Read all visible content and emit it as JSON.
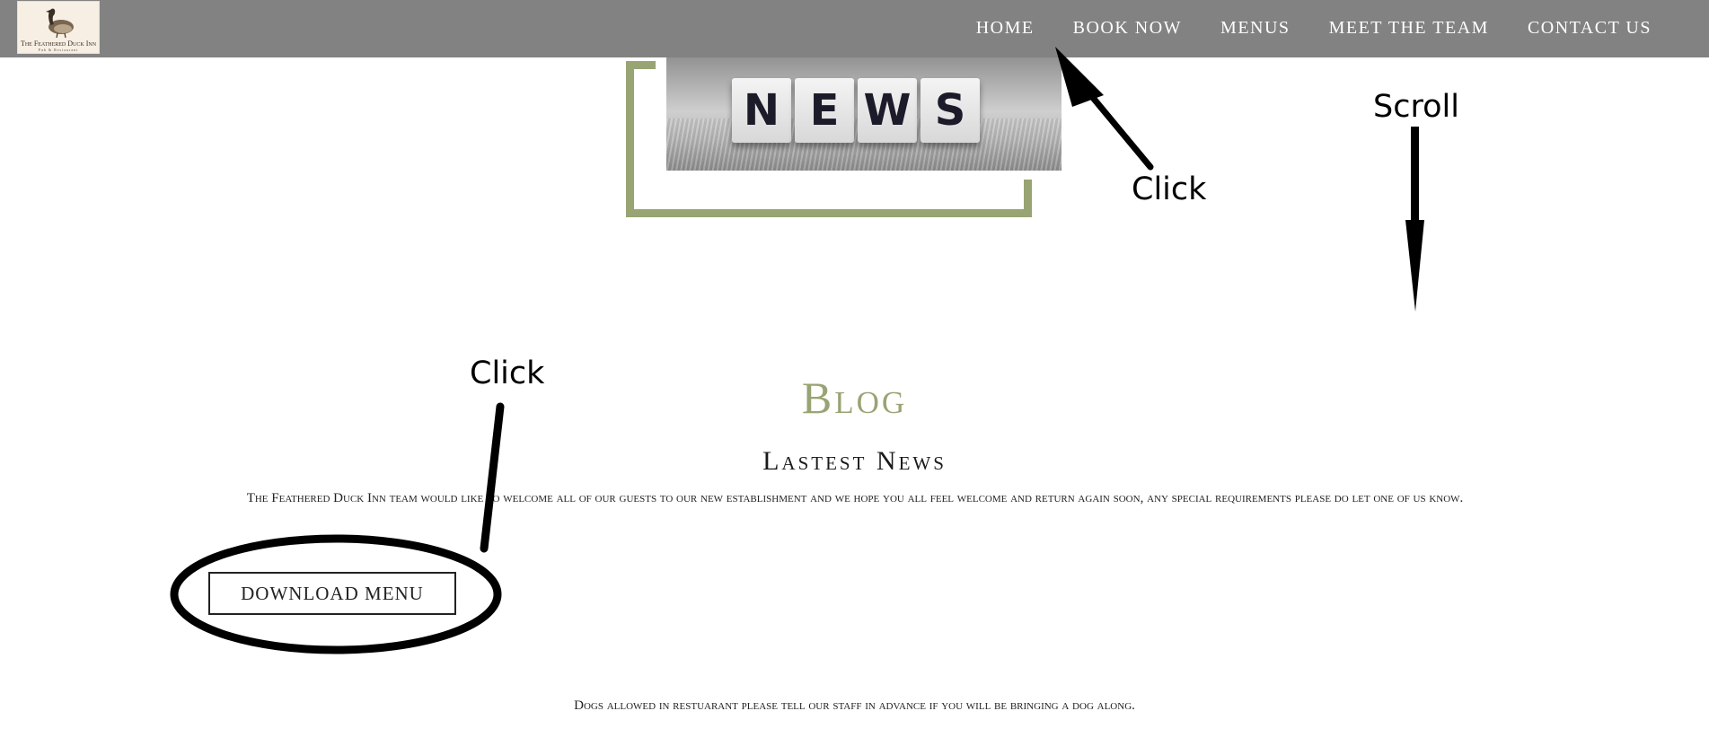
{
  "header": {
    "logo_name": "The Feathered Duck Inn",
    "logo_tagline": "Pub & Restaurant",
    "nav": [
      "HOME",
      "BOOK NOW",
      "MENUS",
      "MEET THE TEAM",
      "CONTACT US"
    ]
  },
  "hero": {
    "tiles": [
      "N",
      "E",
      "W",
      "S"
    ]
  },
  "annotations": {
    "click_home": "Click",
    "scroll": "Scroll",
    "click_download": "Click"
  },
  "main": {
    "title": "Blog",
    "subtitle": "Lastest News",
    "paragraph": "The Feathered Duck Inn team would like to welcome all of our guests to our new establishment and we hope you all feel welcome and return again soon, any special requirements please do let one of us know.",
    "download_label": "DOWNLOAD MENU",
    "dogs_note": "Dogs allowed in restuarant please tell our staff in advance if you will be bringing a dog along."
  },
  "colors": {
    "header_bg": "#828282",
    "accent_green": "#98a473",
    "annotation": "#000000"
  }
}
